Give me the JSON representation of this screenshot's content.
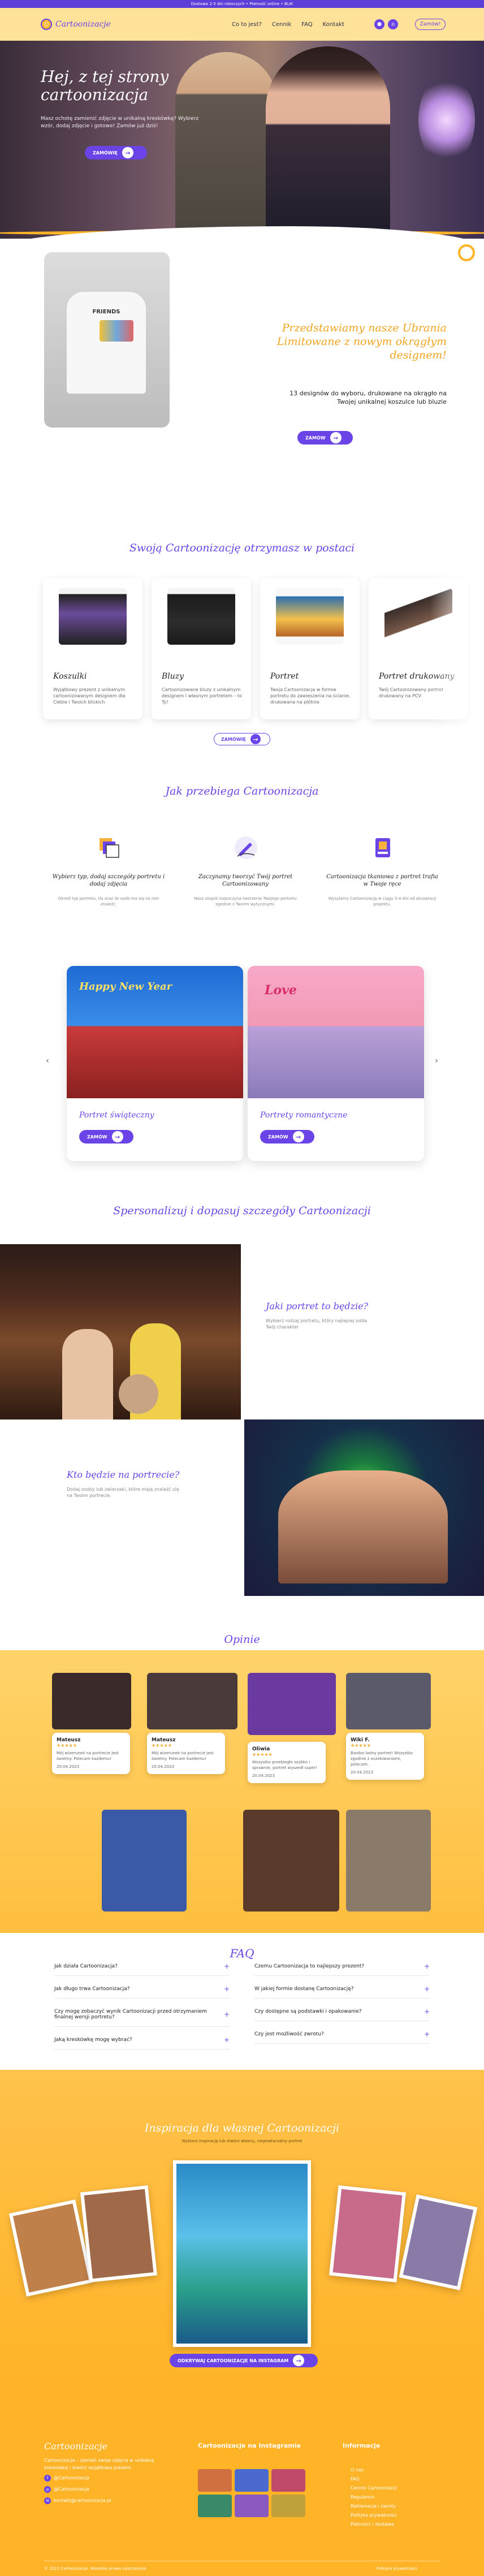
{
  "topbar": {
    "text": "Dostawa 2-5 dni roboczych • Płatność online • BLIK"
  },
  "nav": {
    "logo_text": "Cartoonizacje",
    "links": [
      "Co to jest?",
      "Cennik",
      "FAQ",
      "Kontakt"
    ],
    "cta": "Zamów!"
  },
  "hero": {
    "title": "Hej, z tej strony cartoonizacja",
    "subtitle": "Masz ochotę zamienić zdjęcie w unikalną kreskówkę? Wybierz wzór, dodaj zdjęcie i gotowe! Zamów już dziś!",
    "cta": "ZAMÓWIĘ"
  },
  "limited": {
    "title": "Przedstawiamy nasze Ubrania Limitowane z nowym okrągłym designem!",
    "text": "13 designów do wyboru, drukowane na okrągło na Twojej unikalnej koszulce lub bluzie",
    "cta": "ZAMÓW",
    "shirt_print": "FRIENDS"
  },
  "products": {
    "title": "Swoją Cartoonizację otrzymasz w postaci",
    "items": [
      {
        "name": "Koszulki",
        "desc": "Wyjątkowy prezent z unikalnym cartoonizowanym designem dla Ciebie i Twoich bliskich"
      },
      {
        "name": "Bluzy",
        "desc": "Cartoonizowane bluzy z unikalnym designem i własnym portretem – to Ty!"
      },
      {
        "name": "Portret",
        "desc": "Twoja Cartoonizacja w formie portretu do zawieszenia na ścianie, drukowana na płótnie"
      },
      {
        "name": "Portret drukowany",
        "desc": "Twój Cartoonizowany portret drukowany na PCV"
      }
    ],
    "cta": "ZAMÓWIĘ"
  },
  "process": {
    "title": "Jak przebiega Cartoonizacja",
    "steps": [
      {
        "title": "Wybierz typ, dodaj szczegóły portretu i dodaj zdjęcia",
        "text": "Określ typ portretu, tła oraz ile osób ma się na nim znaleźć."
      },
      {
        "title": "Zaczynamy tworzyć Twój portret Cartoonizowany",
        "text": "Nasz zespół rozpoczyna tworzenie Twojego portretu zgodnie z Twoimi wytycznymi."
      },
      {
        "title": "Cartoonizacja tkaniowa z portret trafia w Twoje ręce",
        "text": "Wysyłamy Cartoonizację w ciągu 3-4 dni od akceptacji projektu."
      }
    ],
    "portraits": [
      {
        "name": "Portret świąteczny",
        "cta": "ZAMÓW",
        "banner": "Happy New Year"
      },
      {
        "name": "Portrety romantyczne",
        "cta": "ZAMÓW",
        "banner": "Love"
      }
    ]
  },
  "personalize": {
    "title": "Spersonalizuj i dopasuj szczegóły Cartoonizacji",
    "q1": {
      "title": "Jaki portret to będzie?",
      "text": "Wybierz rodzaj portretu, który najlepiej odda Twój charakter"
    },
    "q2": {
      "title": "Kto będzie na portrecie?",
      "text": "Dodaj osoby lub zwierzaki, które mają znaleźć się na Twoim portrecie."
    }
  },
  "reviews": {
    "title": "Opinie",
    "items": [
      {
        "name": "Mateusz",
        "stars": "★★★★★",
        "text": "Mój wizerunek na portrecie jest świetny. Polecam każdemu!",
        "date": "20.04.2023"
      },
      {
        "name": "Mateusz",
        "stars": "★★★★★",
        "text": "Mój wizerunek na portrecie jest świetny. Polecam każdemu!",
        "date": "20.04.2023"
      },
      {
        "name": "Oliwia",
        "stars": "★★★★★",
        "text": "Wszystko przebiegło szybko i sprawnie, portret wyszedł super!",
        "date": "20.04.2023"
      },
      {
        "name": "Wiki F.",
        "stars": "★★★★★",
        "text": "Bardzo ładny portret! Wszystko zgodnie z oczekiwaniami, polecam.",
        "date": "20.04.2023"
      }
    ]
  },
  "faq": {
    "title": "FAQ",
    "left": [
      "Jak działa Cartoonizacja?",
      "Jak długo trwa Cartoonizacja?",
      "Czy mogę zobaczyć wynik Cartoonizacji przed otrzymaniem finalnej wersji portretu?",
      "Jaką kreskówkę mogę wybrać?"
    ],
    "right": [
      "Czemu Cartoonizacja to najlepszy prezent?",
      "W jakiej formie dostanę Cartoonizację?",
      "Czy dostępne są podstawki i opakowanie?",
      "Czy jest możliwość zwrotu?"
    ]
  },
  "inspiration": {
    "title": "Inspiracja dla własnej Cartoonizacji",
    "subtitle": "Wybierz inspirację lub stwórz własny, niepowtarzalny portret",
    "cta": "ODKRYWAJ CARTOONIZACJE NA INSTAGRAM"
  },
  "footer": {
    "brand": "Cartoonizacje",
    "about": "Cartoonizacje – zamień swoje zdjęcia w unikalną kreskówkę i stwórz wyjątkowy prezent.",
    "social": [
      "@Cartoonizacja",
      "@Cartoonizacja",
      "kontakt@cartoonizacja.pl"
    ],
    "gallery_title": "Cartoonizacje na Instagramie",
    "info_title": "Informacje",
    "links": [
      "O nas",
      "FAQ",
      "Cennik Cartoonizacji",
      "Regulamin",
      "Reklamacje i zwroty",
      "Polityka prywatności",
      "Płatności i dostawa"
    ],
    "copyright": "© 2023 Cartoonizacje. Wszelkie prawa zastrzeżone.",
    "policy": "Polityka prywatności"
  },
  "colors": {
    "accent": "#6b44e8",
    "yellow": "#ffb327",
    "orange_title": "#f2a51f"
  }
}
